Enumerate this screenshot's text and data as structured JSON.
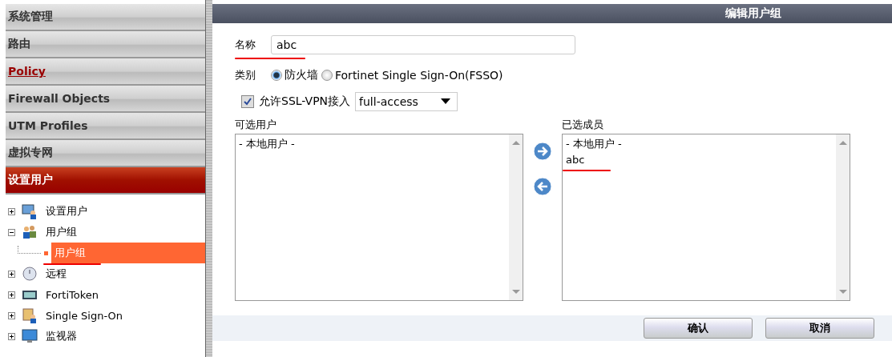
{
  "sidebar": {
    "menu": [
      {
        "label": "系统管理",
        "kind": "plain",
        "selected": false
      },
      {
        "label": "路由",
        "kind": "plain",
        "selected": false
      },
      {
        "label": "Policy",
        "kind": "link",
        "selected": false
      },
      {
        "label": "Firewall Objects",
        "kind": "plain",
        "selected": false
      },
      {
        "label": "UTM Profiles",
        "kind": "plain",
        "selected": false
      },
      {
        "label": "虚拟专网",
        "kind": "plain",
        "selected": false
      },
      {
        "label": "设置用户",
        "kind": "plain",
        "selected": true
      }
    ],
    "tree": [
      {
        "label": "设置用户",
        "kind": "user",
        "expanded": false,
        "selected": false
      },
      {
        "label": "用户组",
        "kind": "group",
        "expanded": true,
        "selected": false,
        "children": [
          {
            "label": "用户组",
            "selected": true
          }
        ]
      },
      {
        "label": "远程",
        "kind": "clock",
        "expanded": false,
        "selected": false
      },
      {
        "label": "FortiToken",
        "kind": "token",
        "expanded": false,
        "selected": false
      },
      {
        "label": "Single Sign-On",
        "kind": "sso",
        "expanded": false,
        "selected": false
      },
      {
        "label": "监视器",
        "kind": "monitor",
        "expanded": false,
        "selected": false
      }
    ]
  },
  "dialog": {
    "title": "编辑用户组",
    "name": {
      "label": "名称",
      "value": "abc"
    },
    "type": {
      "label": "类别",
      "options": [
        {
          "label": "防火墙",
          "selected": true
        },
        {
          "label": "Fortinet Single Sign-On(FSSO)",
          "selected": false
        }
      ]
    },
    "ssl_vpn": {
      "label": "允许SSL-VPN接入",
      "checked": true,
      "value": "full-access"
    },
    "available": {
      "label": "可选用户",
      "items": [
        "- 本地用户 -"
      ]
    },
    "members": {
      "label": "已选成员",
      "items": [
        "- 本地用户 -",
        "abc"
      ]
    },
    "buttons": [
      "确认",
      "取消"
    ]
  }
}
